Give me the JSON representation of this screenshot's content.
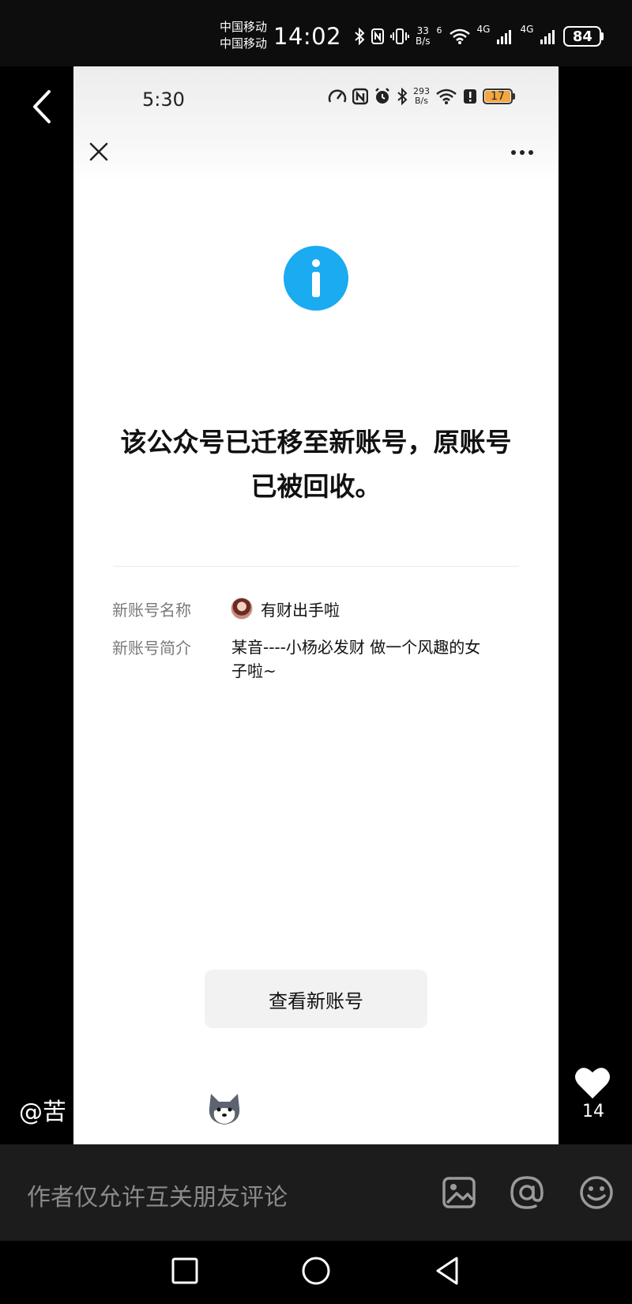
{
  "outer_status": {
    "carrier_1": "中国移动",
    "carrier_2": "中国移动",
    "time": "14:02",
    "speed_value": "33",
    "speed_unit": "B/s",
    "wifi_label": "6",
    "network_1": "4G",
    "network_2": "4G",
    "battery": "84"
  },
  "inner_status": {
    "time": "5:30",
    "speed_value": "293",
    "speed_unit": "B/s",
    "battery": "17",
    "battery_color": "#f4a640"
  },
  "notice": {
    "info_color": "#1aabf0",
    "headline_line1": "该公众号已迁移至新账号，原账号",
    "headline_line2": "已被回收。",
    "name_label": "新账号名称",
    "name_value": "有财出手啦",
    "intro_label": "新账号简介",
    "intro_line1": "某音----小杨必发财 做一个风趣的女",
    "intro_line2": "子啦~",
    "view_button": "查看新账号"
  },
  "post": {
    "author_handle": "@苦",
    "likes": "14"
  },
  "comment_bar": {
    "placeholder": "作者仅允许互关朋友评论"
  },
  "icons": {
    "back": "chevron-left-icon",
    "close": "close-icon",
    "more": "more-icon",
    "info": "info-icon",
    "like": "heart-icon",
    "image": "image-icon",
    "mention": "at-icon",
    "emoji": "emoji-icon",
    "nav_recent": "square-icon",
    "nav_home": "circle-icon",
    "nav_back": "triangle-back-icon"
  }
}
